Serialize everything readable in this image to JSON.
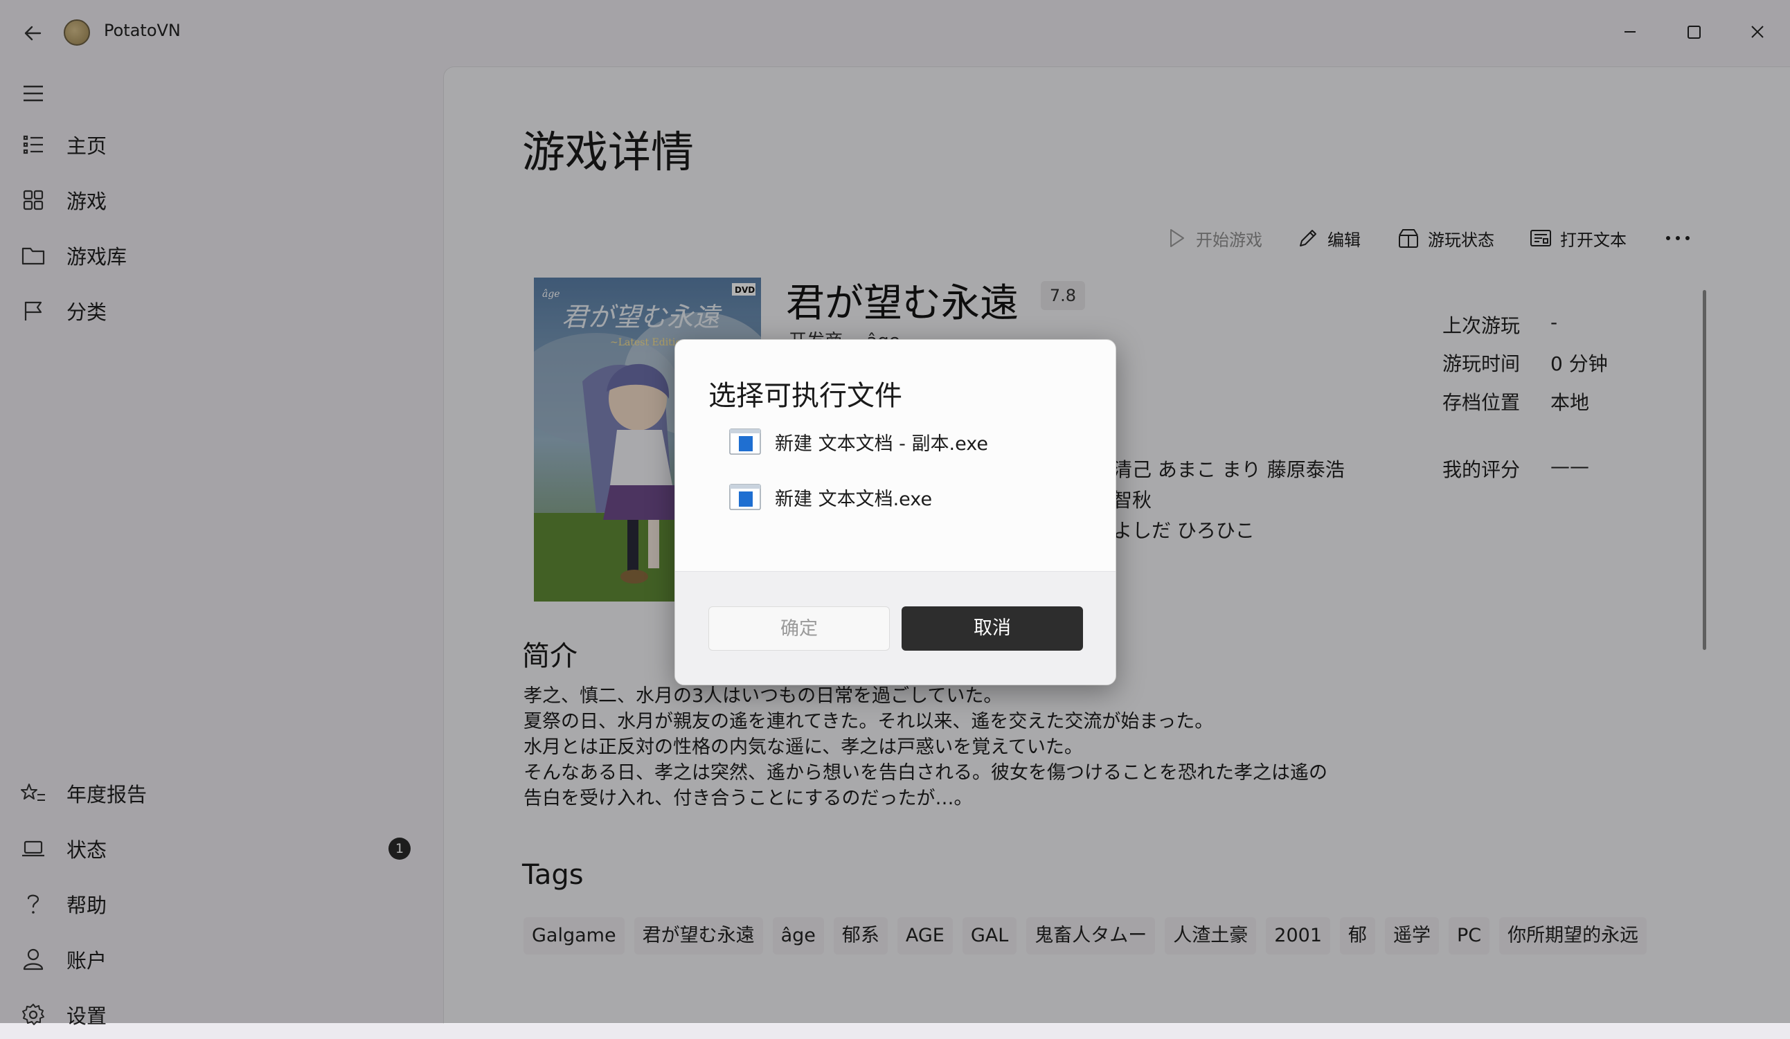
{
  "titlebar": {
    "app_title": "PotatoVN"
  },
  "sidebar": {
    "items": [
      {
        "label": "主页",
        "icon": "list-icon"
      },
      {
        "label": "游戏",
        "icon": "grid-icon"
      },
      {
        "label": "游戏库",
        "icon": "folder-icon"
      },
      {
        "label": "分类",
        "icon": "flag-icon"
      }
    ],
    "footer_items": [
      {
        "label": "年度报告",
        "icon": "star-list-icon"
      },
      {
        "label": "状态",
        "icon": "laptop-icon",
        "badge": "1"
      },
      {
        "label": "帮助",
        "icon": "question-icon"
      },
      {
        "label": "账户",
        "icon": "person-icon"
      },
      {
        "label": "设置",
        "icon": "gear-icon"
      }
    ]
  },
  "page": {
    "title": "游戏详情",
    "commands": {
      "start": "开始游戏",
      "edit": "编辑",
      "status": "游玩状态",
      "open_text": "打开文本"
    }
  },
  "game": {
    "title": "君が望む永遠",
    "rating": "7.8",
    "developer_label": "开发商",
    "developer": "âge",
    "staff_lines": [
      "清己 あまこ まり 藤原泰浩",
      "智秋",
      "よしだ ひろひこ"
    ],
    "info": [
      {
        "key": "上次游玩",
        "value": "-"
      },
      {
        "key": "游玩时间",
        "value": "0 分钟"
      },
      {
        "key": "存档位置",
        "value": "本地"
      },
      {
        "key": "我的评分",
        "value": "——"
      }
    ],
    "summary_heading": "简介",
    "summary_lines": [
      "孝之、慎二、水月の3人はいつもの日常を過ごしていた。",
      "夏祭の日、水月が親友の遙を連れてきた。それ以来、遙を交えた交流が始まった。",
      "水月とは正反対の性格の内気な遥に、孝之は戸惑いを覚えていた。",
      "そんなある日、孝之は突然、遙から想いを告白される。彼女を傷つけることを恐れた孝之は遙の",
      "告白を受け入れ、付き合うことにするのだったが…。"
    ],
    "tags_heading": "Tags",
    "tags": [
      "Galgame",
      "君が望む永遠",
      "âge",
      "郁系",
      "AGE",
      "GAL",
      "鬼畜人タムー",
      "人渣土豪",
      "2001",
      "郁",
      "遥学",
      "PC",
      "你所期望的永远"
    ]
  },
  "dialog": {
    "title": "选择可执行文件",
    "files": [
      "新建 文本文档 - 副本.exe",
      "新建 文本文档.exe"
    ],
    "ok_label": "确定",
    "cancel_label": "取消"
  }
}
